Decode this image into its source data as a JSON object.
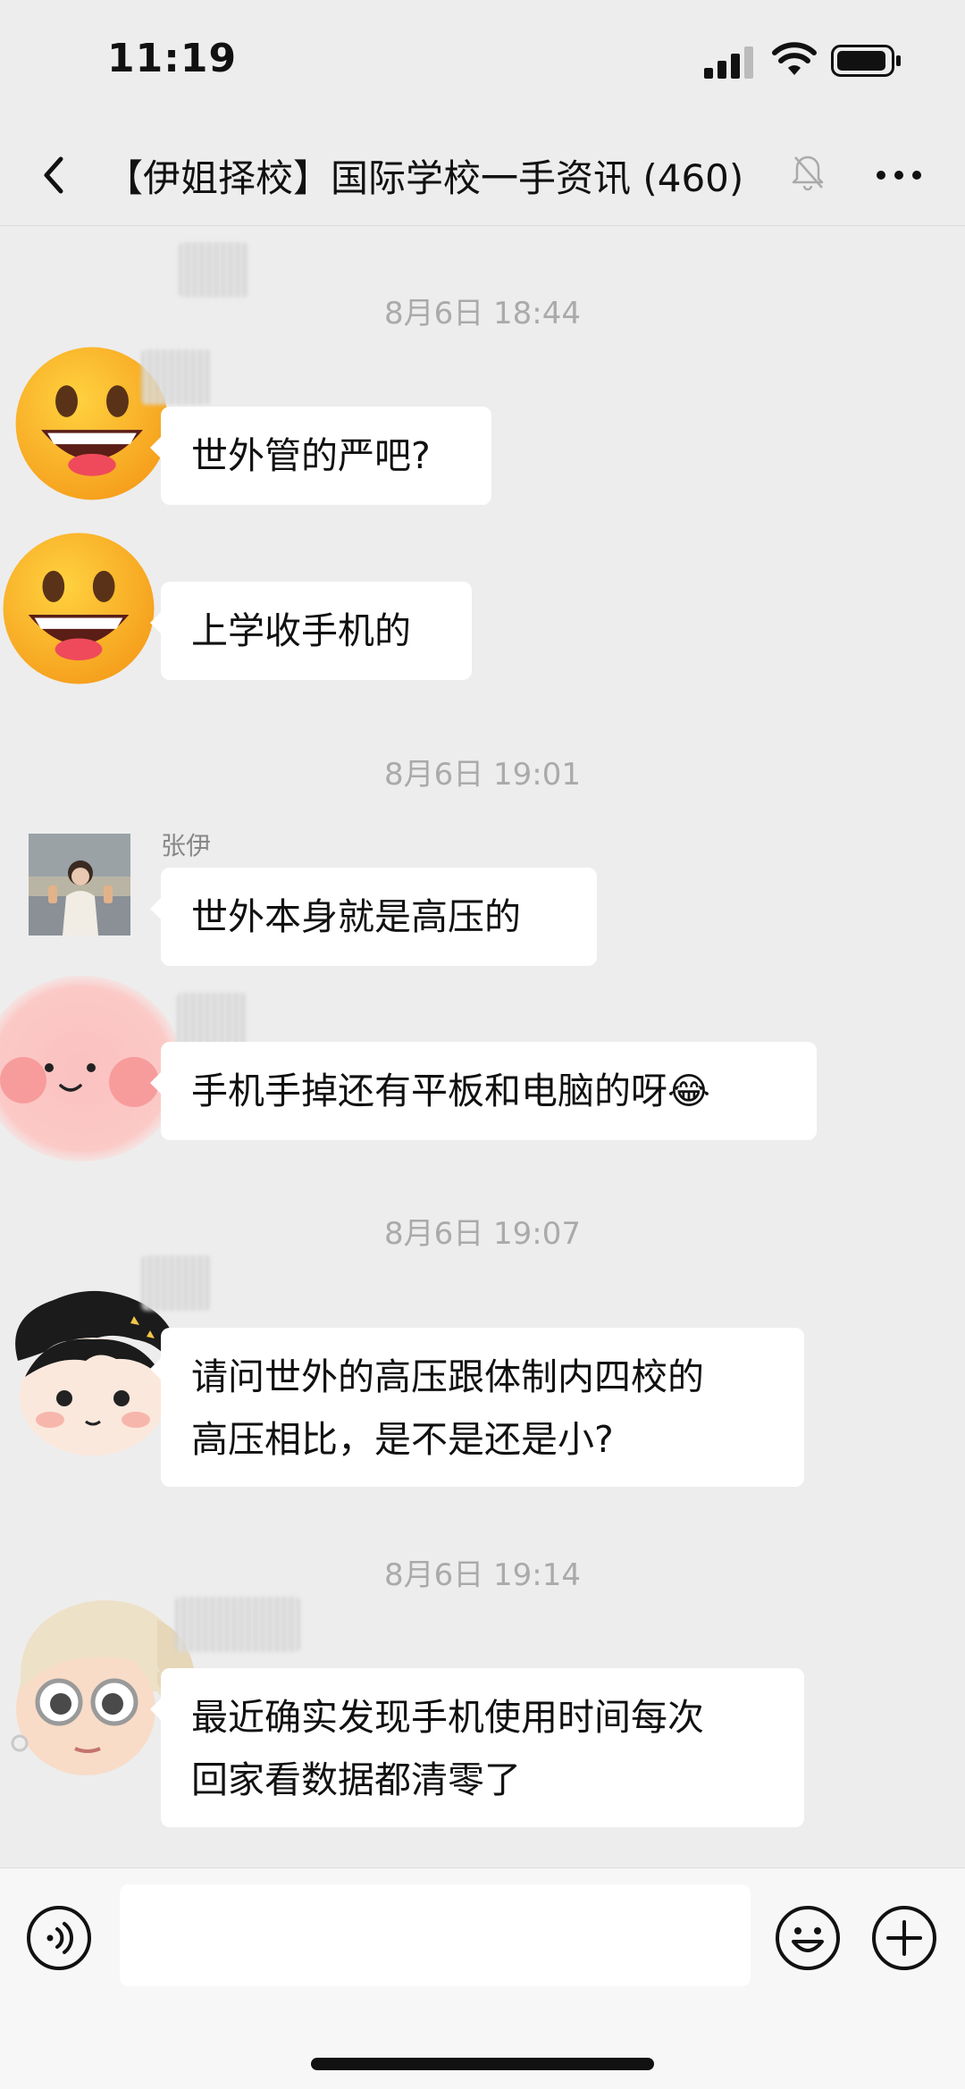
{
  "status_bar": {
    "time": "11:19"
  },
  "nav": {
    "title": "【伊姐择校】国际学校一手资讯 (460)"
  },
  "messages": {
    "ts1": "8月6日 18:44",
    "m1": "世外管的严吧?",
    "m2": "上学收手机的",
    "ts2": "8月6日 19:01",
    "m3_sender": "张伊",
    "m3": "世外本身就是高压的",
    "m4": "手机手掉还有平板和电脑的呀😂",
    "ts3": "8月6日 19:07",
    "m5_line1": "请问世外的高压跟体制内四校的",
    "m5_line2": "高压相比，是不是还是小?",
    "ts4": "8月6日 19:14",
    "m6_line1": "最近确实发现手机使用时间每次",
    "m6_line2": "回家看数据都清零了"
  },
  "colors": {
    "background": "#ededed",
    "bubble": "#ffffff",
    "timestamp": "#aaaaaa"
  },
  "icons": [
    "back-icon",
    "mute-icon",
    "more-icon",
    "voice-icon",
    "emoji-icon",
    "plus-icon"
  ]
}
